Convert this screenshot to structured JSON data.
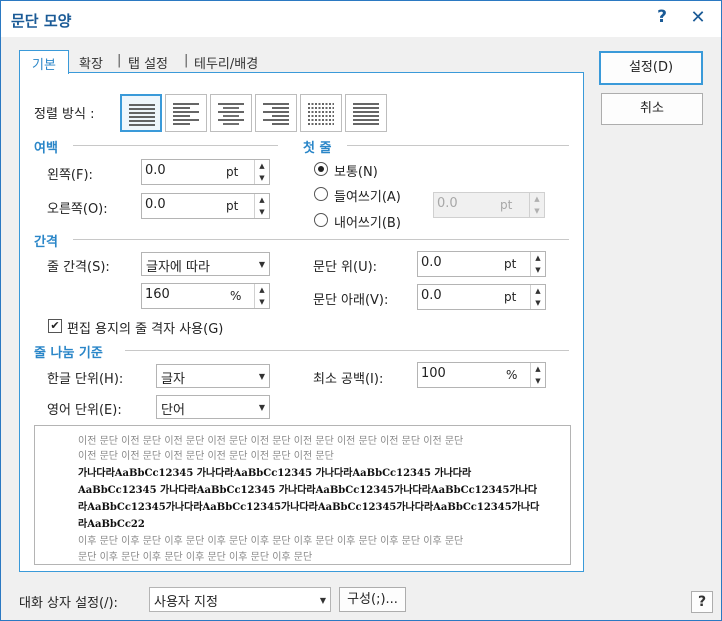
{
  "window": {
    "title": "문단 모양"
  },
  "tabs": [
    {
      "label": "기본"
    },
    {
      "label": "확장"
    },
    {
      "label": "탭 설정"
    },
    {
      "label": "테두리/배경"
    }
  ],
  "tab_separator": "|",
  "buttons": {
    "ok": "설정(D)",
    "cancel": "취소",
    "configure": "구성(;)..."
  },
  "alignment": {
    "label": "정렬 방식 :",
    "options": [
      "justify-icon",
      "align-left-icon",
      "align-center-icon",
      "align-right-icon",
      "distribute-icon",
      "divide-icon"
    ],
    "selected": 0
  },
  "margins": {
    "heading": "여백",
    "left": {
      "label": "왼쪽(F):",
      "value": "0.0",
      "unit": "pt"
    },
    "right": {
      "label": "오른쪽(O):",
      "value": "0.0",
      "unit": "pt"
    }
  },
  "first_line": {
    "heading": "첫 줄",
    "options": [
      "보통(N)",
      "들여쓰기(A)",
      "내어쓰기(B)"
    ],
    "selected": 0,
    "value": "0.0",
    "unit": "pt"
  },
  "spacing": {
    "heading": "간격",
    "line_spacing": {
      "label": "줄 간격(S):",
      "type": "글자에 따라",
      "value": "160",
      "unit": "%"
    },
    "above": {
      "label": "문단 위(U):",
      "value": "0.0",
      "unit": "pt"
    },
    "below": {
      "label": "문단 아래(V):",
      "value": "0.0",
      "unit": "pt"
    },
    "grid_checkbox": {
      "label": "편집 용지의 줄 격자 사용(G)",
      "checked": true
    }
  },
  "line_break": {
    "heading": "줄 나눔 기준",
    "hangul": {
      "label": "한글 단위(H):",
      "value": "글자"
    },
    "english": {
      "label": "영어 단위(E):",
      "value": "단어"
    },
    "min_space": {
      "label": "최소 공백(I):",
      "value": "100",
      "unit": "%"
    }
  },
  "preview": {
    "prev_lines": [
      "이전 문단 이전 문단 이전 문단 이전 문단 이전 문단 이전 문단 이전 문단 이전 문단 이전 문단",
      "이전 문단 이전 문단 이전 문단 이전 문단 이전 문단 이전 문단"
    ],
    "sample_lines": [
      "가나다라AaBbCc12345      가나다라AaBbCc12345      가나다라AaBbCc12345      가나다라",
      "AaBbCc12345  가나다라AaBbCc12345  가나다라AaBbCc12345가나다라AaBbCc12345가나다",
      "라AaBbCc12345가나다라AaBbCc12345가나다라AaBbCc12345가나다라AaBbCc12345가나다",
      "라AaBbCc22"
    ],
    "next_lines": [
      "이후 문단 이후 문단 이후 문단 이후 문단 이후 문단 이후 문단 이후 문단 이후 문단 이후 문단",
      "문단 이후 문단 이후 문단 이후 문단 이후 문단 이후 문단"
    ]
  },
  "footer": {
    "label": "대화 상자 설정(/):",
    "value": "사용자 지정"
  },
  "help_glyph": "?",
  "close_glyph": "✕",
  "colors": {
    "accent": "#2a86c8",
    "title": "#1a5a96"
  }
}
